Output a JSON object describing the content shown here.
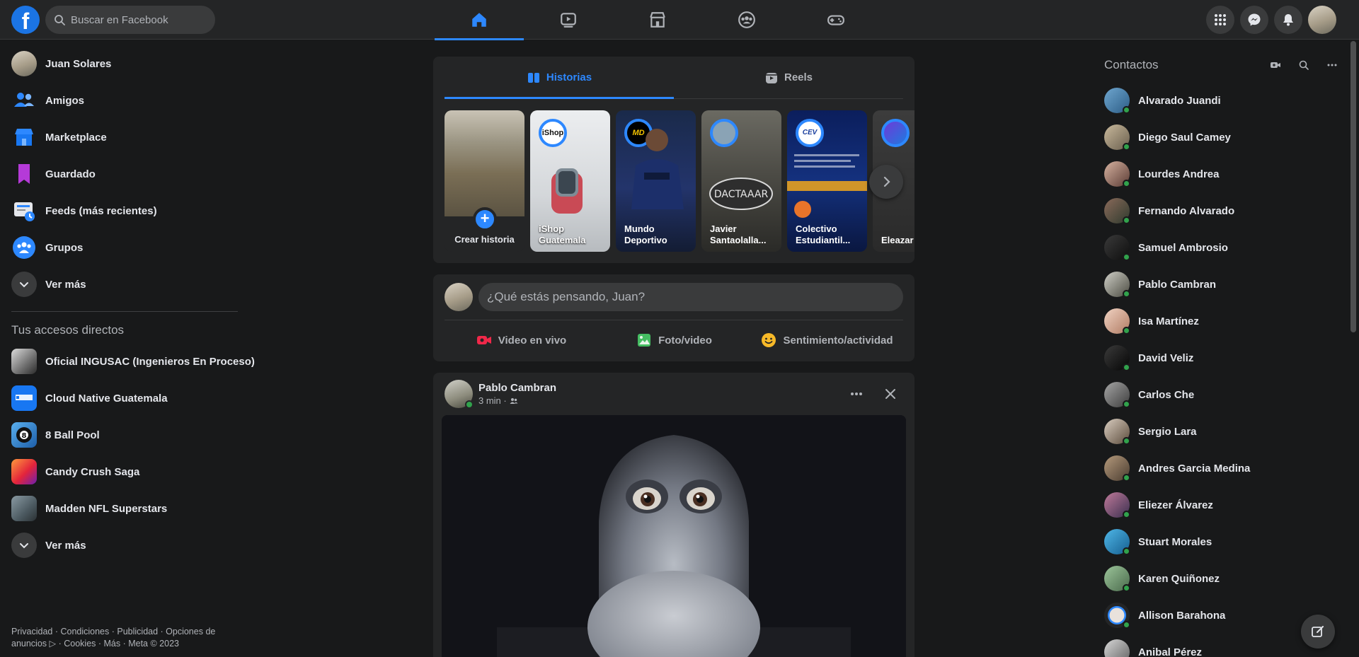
{
  "header": {
    "logo": "f",
    "search_placeholder": "Buscar en Facebook",
    "nav": [
      "home-icon",
      "watch-icon",
      "marketplace-icon",
      "groups-icon",
      "gaming-icon"
    ],
    "actions": [
      "menu-grid-icon",
      "messenger-icon",
      "notifications-icon",
      "account-avatar"
    ]
  },
  "left_sidebar": {
    "items": [
      {
        "label": "Juan Solares",
        "icon": "profile-avatar"
      },
      {
        "label": "Amigos",
        "icon": "friends-icon"
      },
      {
        "label": "Marketplace",
        "icon": "marketplace-icon"
      },
      {
        "label": "Guardado",
        "icon": "saved-icon"
      },
      {
        "label": "Feeds (más recientes)",
        "icon": "feeds-icon"
      },
      {
        "label": "Grupos",
        "icon": "groups-icon"
      },
      {
        "label": "Ver más",
        "icon": "chevron-down-icon"
      }
    ],
    "shortcuts_title": "Tus accesos directos",
    "shortcuts": [
      {
        "label": "Oficial INGUSAC (Ingenieros En Proceso)"
      },
      {
        "label": "Cloud Native Guatemala"
      },
      {
        "label": "8 Ball Pool"
      },
      {
        "label": "Candy Crush Saga"
      },
      {
        "label": "Madden NFL Superstars"
      },
      {
        "label": "Ver más"
      }
    ],
    "footer_line1": "Privacidad · Condiciones · Publicidad · Opciones de",
    "footer_line2": "anuncios ▷ · Cookies · Más · Meta © 2023"
  },
  "stories": {
    "tabs": [
      "Historias",
      "Reels"
    ],
    "create_label": "Crear historia",
    "items": [
      {
        "name": "iShop Guatemala",
        "ring_label": "iShop"
      },
      {
        "name": "Mundo Deportivo",
        "ring_label": "MD"
      },
      {
        "name": "Javier Santaolalla...",
        "ring_label": ""
      },
      {
        "name": "Colectivo Estudiantil...",
        "ring_label": "CEV"
      },
      {
        "name": "Eleazar M",
        "ring_label": ""
      }
    ]
  },
  "composer": {
    "placeholder": "¿Qué estás pensando, Juan?",
    "actions": [
      "Video en vivo",
      "Foto/video",
      "Sentimiento/actividad"
    ]
  },
  "post": {
    "author": "Pablo Cambran",
    "time": "3 min ·"
  },
  "contacts": {
    "title": "Contactos",
    "list": [
      "Alvarado Juandi",
      "Diego Saul Camey",
      "Lourdes Andrea",
      "Fernando Alvarado",
      "Samuel Ambrosio",
      "Pablo Cambran",
      "Isa Martínez",
      "David Veliz",
      "Carlos Che",
      "Sergio Lara",
      "Andres Garcia Medina",
      "Eliezer Álvarez",
      "Stuart Morales",
      "Karen Quiñonez",
      "Allison Barahona",
      "Anibal Pérez"
    ]
  },
  "colors": {
    "accent": "#2d88ff",
    "online": "#31a24c",
    "background": "#18191a",
    "surface": "#242526"
  }
}
